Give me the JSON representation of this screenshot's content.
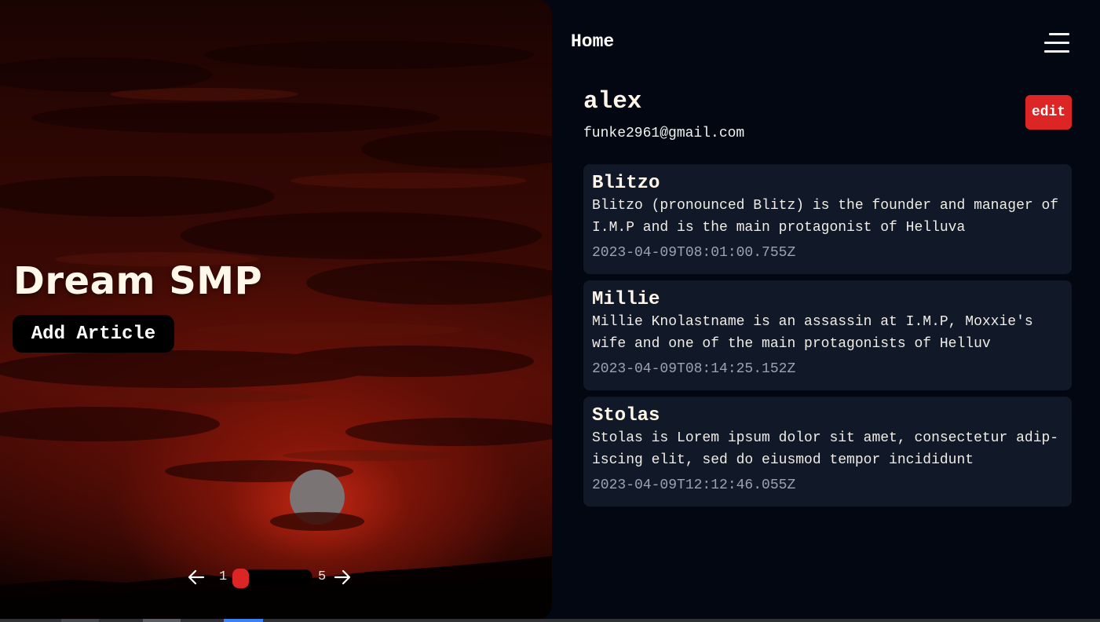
{
  "hero": {
    "title": "Dream SMP",
    "add_article_label": "Add Article"
  },
  "pager": {
    "min": "1",
    "max": "5",
    "current_fraction": 0.0,
    "left_icon": "arrow-left-icon",
    "right_icon": "arrow-right-icon",
    "accent": "#dc2626"
  },
  "nav": {
    "title": "Home",
    "menu_icon": "hamburger-menu-icon"
  },
  "profile": {
    "name": "alex",
    "email": "funke2961@gmail.com",
    "edit_label": "edit"
  },
  "articles": [
    {
      "title": "Blitzo",
      "body": "Blitzo (pronounced Blitz) is the founder and manager of I.M.P and is the main protagonist of Helluva",
      "date": "2023-04-09T08:01:00.755Z"
    },
    {
      "title": "Millie",
      "body": "Millie Knolastname is an assassin at I.M.P, Moxxie's wife and one of the main protagonists of Helluv",
      "date": "2023-04-09T08:14:25.152Z"
    },
    {
      "title": "Stolas",
      "body": "Stolas is Lorem ipsum dolor sit amet, consectetur adip-iscing elit, sed do eiusmod tempor incididunt",
      "date": "2023-04-09T12:12:46.055Z"
    }
  ],
  "colors": {
    "background": "#030712",
    "card": "#111827",
    "accent": "#dc2626",
    "date_text": "#9ca3af"
  }
}
